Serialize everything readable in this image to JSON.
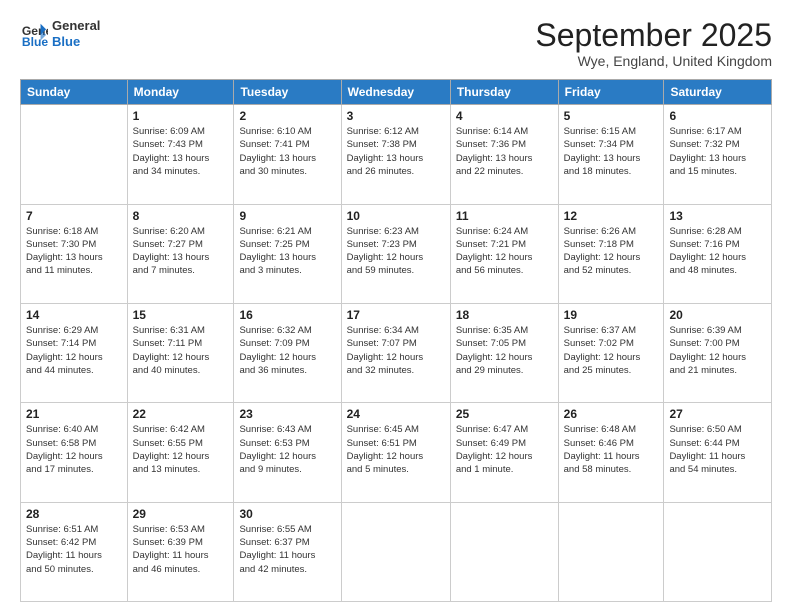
{
  "header": {
    "logo_line1": "General",
    "logo_line2": "Blue",
    "month_title": "September 2025",
    "location": "Wye, England, United Kingdom"
  },
  "days_of_week": [
    "Sunday",
    "Monday",
    "Tuesday",
    "Wednesday",
    "Thursday",
    "Friday",
    "Saturday"
  ],
  "weeks": [
    [
      {
        "day": "",
        "info": ""
      },
      {
        "day": "1",
        "info": "Sunrise: 6:09 AM\nSunset: 7:43 PM\nDaylight: 13 hours\nand 34 minutes."
      },
      {
        "day": "2",
        "info": "Sunrise: 6:10 AM\nSunset: 7:41 PM\nDaylight: 13 hours\nand 30 minutes."
      },
      {
        "day": "3",
        "info": "Sunrise: 6:12 AM\nSunset: 7:38 PM\nDaylight: 13 hours\nand 26 minutes."
      },
      {
        "day": "4",
        "info": "Sunrise: 6:14 AM\nSunset: 7:36 PM\nDaylight: 13 hours\nand 22 minutes."
      },
      {
        "day": "5",
        "info": "Sunrise: 6:15 AM\nSunset: 7:34 PM\nDaylight: 13 hours\nand 18 minutes."
      },
      {
        "day": "6",
        "info": "Sunrise: 6:17 AM\nSunset: 7:32 PM\nDaylight: 13 hours\nand 15 minutes."
      }
    ],
    [
      {
        "day": "7",
        "info": "Sunrise: 6:18 AM\nSunset: 7:30 PM\nDaylight: 13 hours\nand 11 minutes."
      },
      {
        "day": "8",
        "info": "Sunrise: 6:20 AM\nSunset: 7:27 PM\nDaylight: 13 hours\nand 7 minutes."
      },
      {
        "day": "9",
        "info": "Sunrise: 6:21 AM\nSunset: 7:25 PM\nDaylight: 13 hours\nand 3 minutes."
      },
      {
        "day": "10",
        "info": "Sunrise: 6:23 AM\nSunset: 7:23 PM\nDaylight: 12 hours\nand 59 minutes."
      },
      {
        "day": "11",
        "info": "Sunrise: 6:24 AM\nSunset: 7:21 PM\nDaylight: 12 hours\nand 56 minutes."
      },
      {
        "day": "12",
        "info": "Sunrise: 6:26 AM\nSunset: 7:18 PM\nDaylight: 12 hours\nand 52 minutes."
      },
      {
        "day": "13",
        "info": "Sunrise: 6:28 AM\nSunset: 7:16 PM\nDaylight: 12 hours\nand 48 minutes."
      }
    ],
    [
      {
        "day": "14",
        "info": "Sunrise: 6:29 AM\nSunset: 7:14 PM\nDaylight: 12 hours\nand 44 minutes."
      },
      {
        "day": "15",
        "info": "Sunrise: 6:31 AM\nSunset: 7:11 PM\nDaylight: 12 hours\nand 40 minutes."
      },
      {
        "day": "16",
        "info": "Sunrise: 6:32 AM\nSunset: 7:09 PM\nDaylight: 12 hours\nand 36 minutes."
      },
      {
        "day": "17",
        "info": "Sunrise: 6:34 AM\nSunset: 7:07 PM\nDaylight: 12 hours\nand 32 minutes."
      },
      {
        "day": "18",
        "info": "Sunrise: 6:35 AM\nSunset: 7:05 PM\nDaylight: 12 hours\nand 29 minutes."
      },
      {
        "day": "19",
        "info": "Sunrise: 6:37 AM\nSunset: 7:02 PM\nDaylight: 12 hours\nand 25 minutes."
      },
      {
        "day": "20",
        "info": "Sunrise: 6:39 AM\nSunset: 7:00 PM\nDaylight: 12 hours\nand 21 minutes."
      }
    ],
    [
      {
        "day": "21",
        "info": "Sunrise: 6:40 AM\nSunset: 6:58 PM\nDaylight: 12 hours\nand 17 minutes."
      },
      {
        "day": "22",
        "info": "Sunrise: 6:42 AM\nSunset: 6:55 PM\nDaylight: 12 hours\nand 13 minutes."
      },
      {
        "day": "23",
        "info": "Sunrise: 6:43 AM\nSunset: 6:53 PM\nDaylight: 12 hours\nand 9 minutes."
      },
      {
        "day": "24",
        "info": "Sunrise: 6:45 AM\nSunset: 6:51 PM\nDaylight: 12 hours\nand 5 minutes."
      },
      {
        "day": "25",
        "info": "Sunrise: 6:47 AM\nSunset: 6:49 PM\nDaylight: 12 hours\nand 1 minute."
      },
      {
        "day": "26",
        "info": "Sunrise: 6:48 AM\nSunset: 6:46 PM\nDaylight: 11 hours\nand 58 minutes."
      },
      {
        "day": "27",
        "info": "Sunrise: 6:50 AM\nSunset: 6:44 PM\nDaylight: 11 hours\nand 54 minutes."
      }
    ],
    [
      {
        "day": "28",
        "info": "Sunrise: 6:51 AM\nSunset: 6:42 PM\nDaylight: 11 hours\nand 50 minutes."
      },
      {
        "day": "29",
        "info": "Sunrise: 6:53 AM\nSunset: 6:39 PM\nDaylight: 11 hours\nand 46 minutes."
      },
      {
        "day": "30",
        "info": "Sunrise: 6:55 AM\nSunset: 6:37 PM\nDaylight: 11 hours\nand 42 minutes."
      },
      {
        "day": "",
        "info": ""
      },
      {
        "day": "",
        "info": ""
      },
      {
        "day": "",
        "info": ""
      },
      {
        "day": "",
        "info": ""
      }
    ]
  ]
}
